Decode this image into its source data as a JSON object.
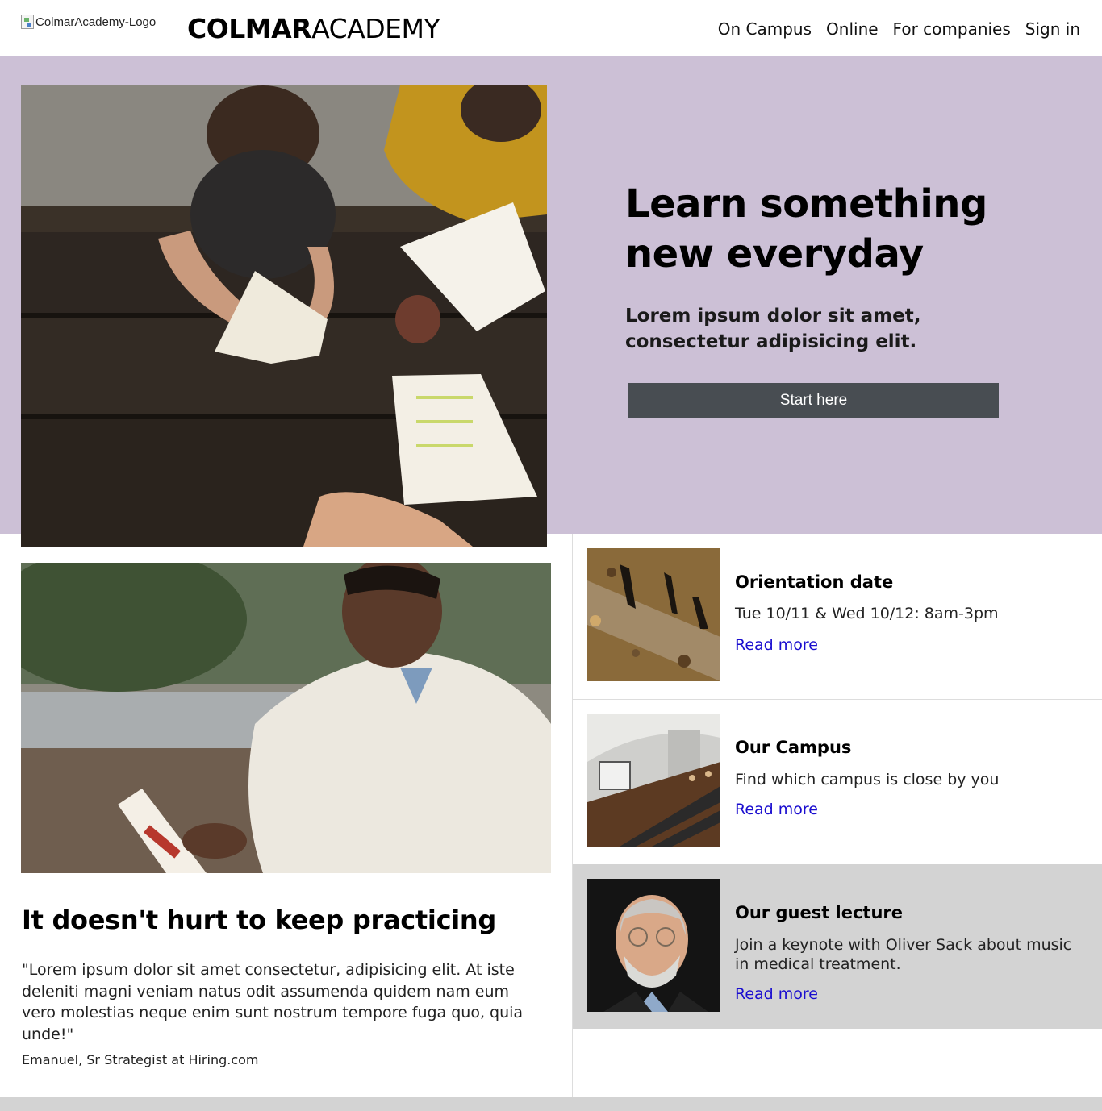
{
  "header": {
    "logo_alt": "ColmarAcademy-Logo",
    "brand_bold": "COLMAR",
    "brand_light": "ACADEMY",
    "nav": [
      "On Campus",
      "Online",
      "For companies",
      "Sign in"
    ]
  },
  "hero": {
    "title_line1": "Learn something",
    "title_line2": "new everyday",
    "subtitle": "Lorem ipsum dolor sit amet, consectetur adipisicing elit.",
    "button": "Start here"
  },
  "feature": {
    "title": "It doesn't hurt to keep practicing",
    "quote": "\"Lorem ipsum dolor sit amet consectetur, adipisicing elit. At iste deleniti magni veniam natus odit assumenda quidem nam eum vero molestias neque enim sunt nostrum tempore fuga quo, quia unde!\"",
    "attribution": "Emanuel, Sr Strategist at Hiring.com"
  },
  "cards": [
    {
      "title": "Orientation date",
      "desc": "Tue 10/11 & Wed 10/12: 8am-3pm",
      "link": "Read more"
    },
    {
      "title": "Our Campus",
      "desc": "Find which campus is close by you",
      "link": "Read more"
    },
    {
      "title": "Our guest lecture",
      "desc": "Join a keynote with Oliver Sack about music in medical treatment.",
      "link": "Read more"
    }
  ],
  "colors": {
    "hero_bg": "#ccc0d6",
    "button_bg": "#484d52",
    "link": "#1a0dcf",
    "highlight_card": "#d3d3d3"
  }
}
